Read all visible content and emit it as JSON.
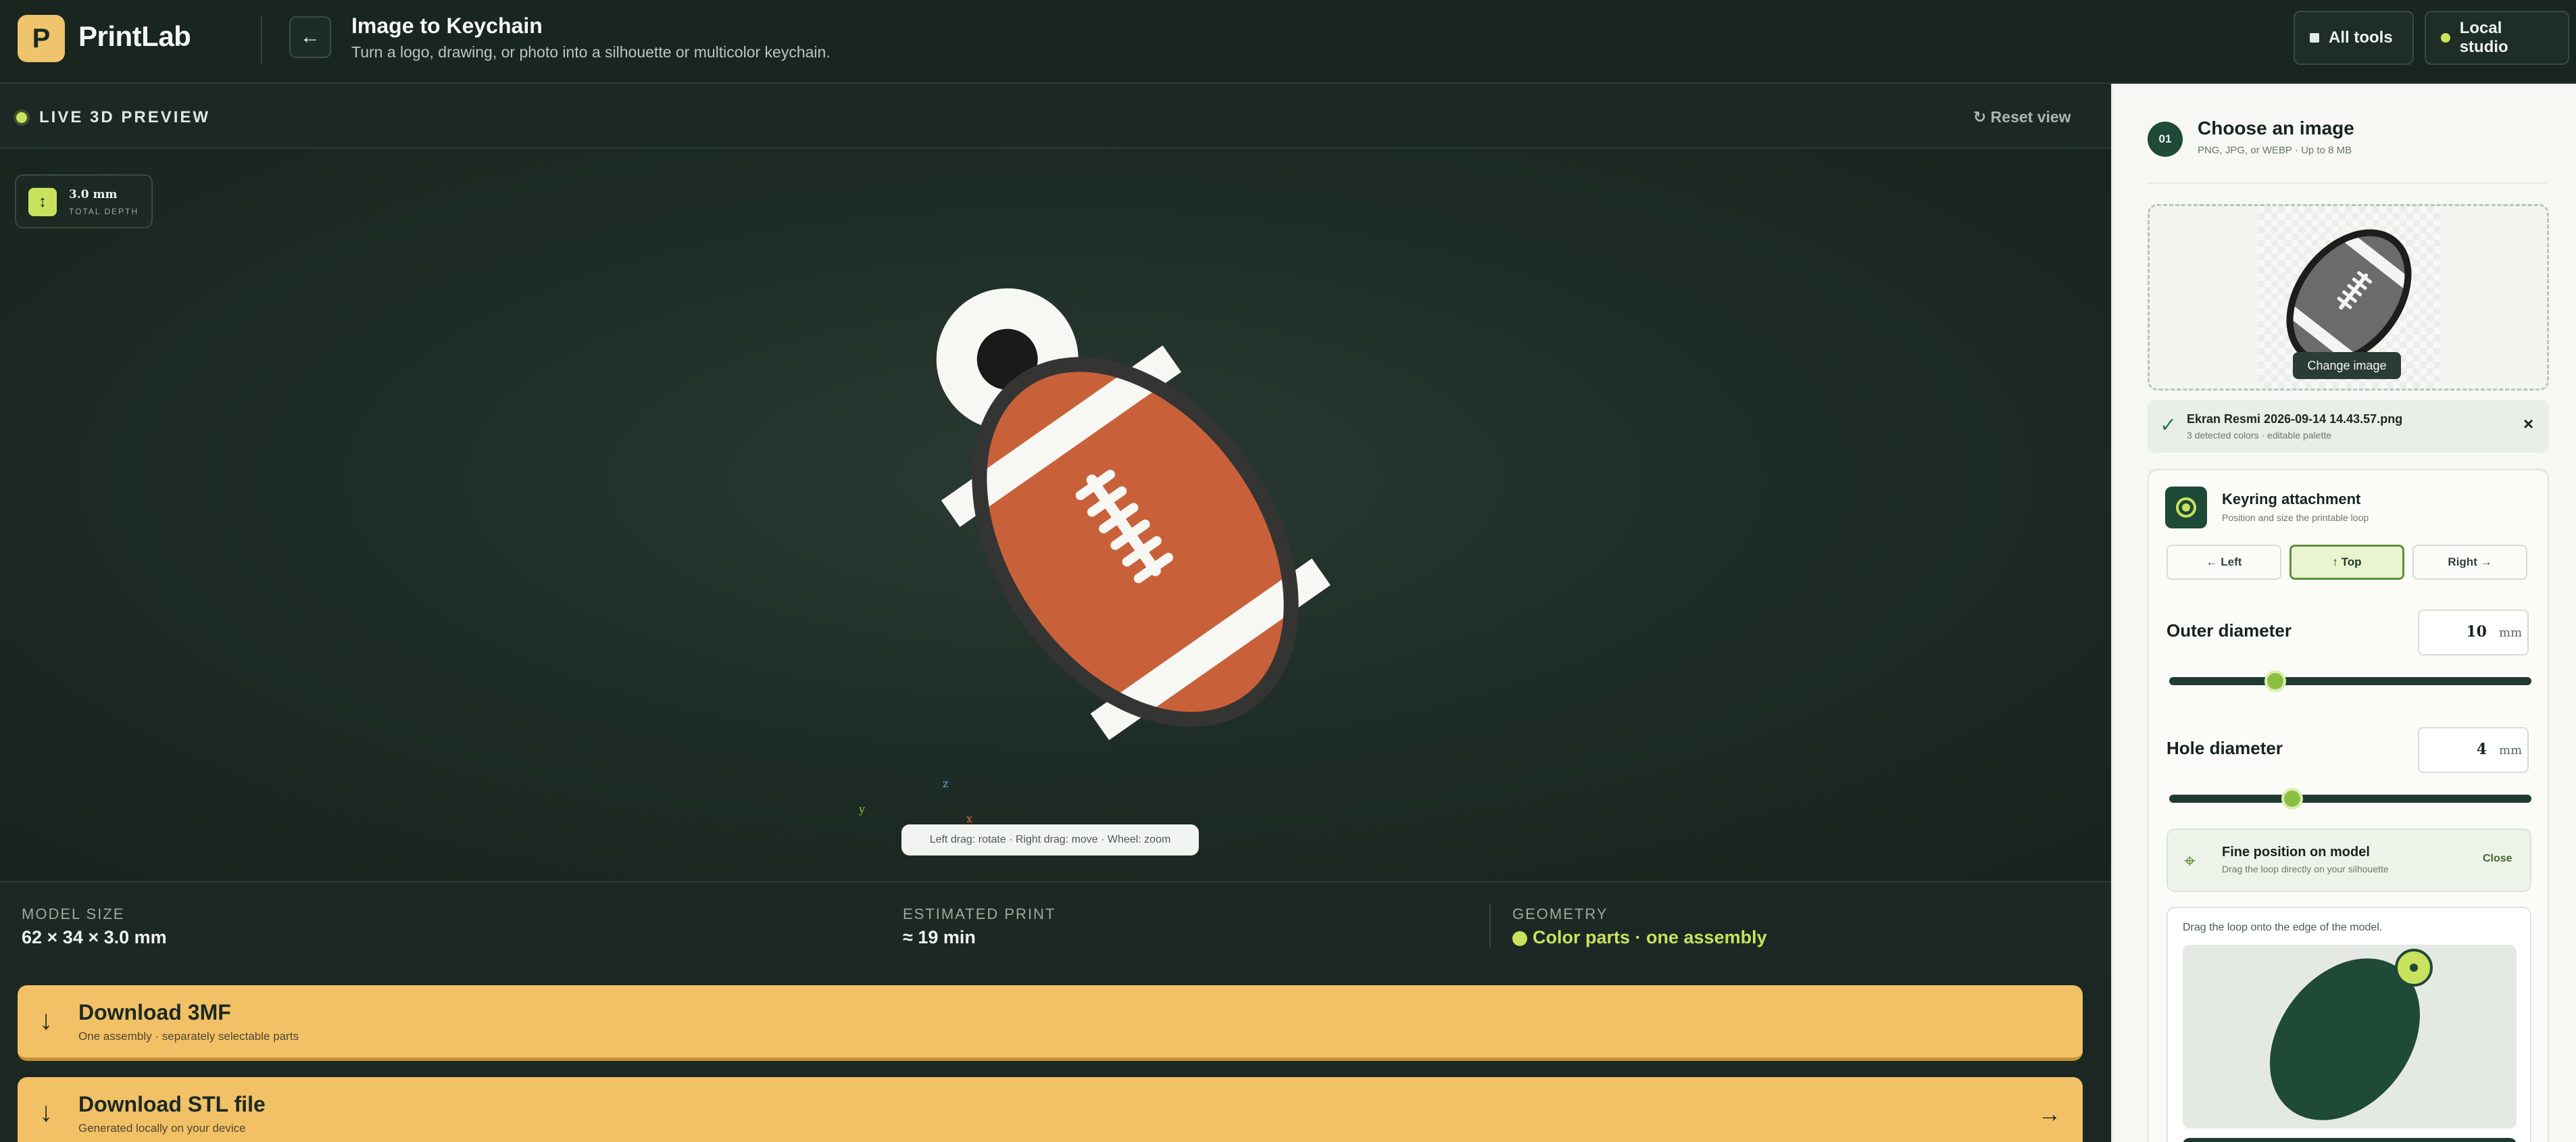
{
  "app": {
    "logo_letter": "P",
    "name": "PrintLab"
  },
  "header": {
    "title": "Image to Keychain",
    "subtitle": "Turn a logo, drawing, or photo into a silhouette or multicolor keychain.",
    "all_tools_label": "All tools",
    "local_studio_label": "Local studio"
  },
  "preview": {
    "live_label": "LIVE 3D PREVIEW",
    "reset_label": "Reset view",
    "depth_value": "3.0 mm",
    "depth_caption": "TOTAL DEPTH",
    "hint": "Left drag: rotate · Right drag: move · Wheel: zoom",
    "axes": {
      "z": "z",
      "y": "y",
      "x": "x"
    }
  },
  "stats": {
    "model_size_label": "MODEL SIZE",
    "model_size_value": "62 × 34 × 3.0 mm",
    "print_label": "ESTIMATED PRINT",
    "print_value": "≈ 19 min",
    "geometry_label": "GEOMETRY",
    "geometry_value": "Color parts · one assembly"
  },
  "downloads": [
    {
      "title": "Download 3MF",
      "subtitle": "One assembly · separately selectable parts"
    },
    {
      "title": "Download STL file",
      "subtitle": "Generated locally on your device"
    }
  ],
  "sidebar": {
    "step_number": "01",
    "step_title": "Choose an image",
    "step_subtitle": "PNG, JPG, or WEBP · Up to 8 MB",
    "change_image_label": "Change image",
    "file_name": "Ekran Resmi 2026-09-14 14.43.57.png",
    "file_meta": "3 detected colors · editable palette",
    "keyring": {
      "title": "Keyring attachment",
      "subtitle": "Position and size the printable loop",
      "positions": [
        "← Left",
        "↑ Top",
        "Right →"
      ],
      "selected_position": "↑ Top",
      "outer_label": "Outer diameter",
      "outer_value": "10",
      "outer_level": 0.28,
      "hole_label": "Hole diameter",
      "hole_value": "4",
      "hole_level": 0.33,
      "unit": "mm",
      "fine_title": "Fine position on model",
      "fine_subtitle": "Drag the loop directly on your silhouette",
      "fine_close": "Close",
      "drag_hint": "Drag the loop onto the edge of the model."
    }
  },
  "colors": {
    "accent_lime": "#c8e25d",
    "download_amber": "#f2c166",
    "ball_brown": "#c8613a",
    "dark_green": "#1f4a38"
  }
}
